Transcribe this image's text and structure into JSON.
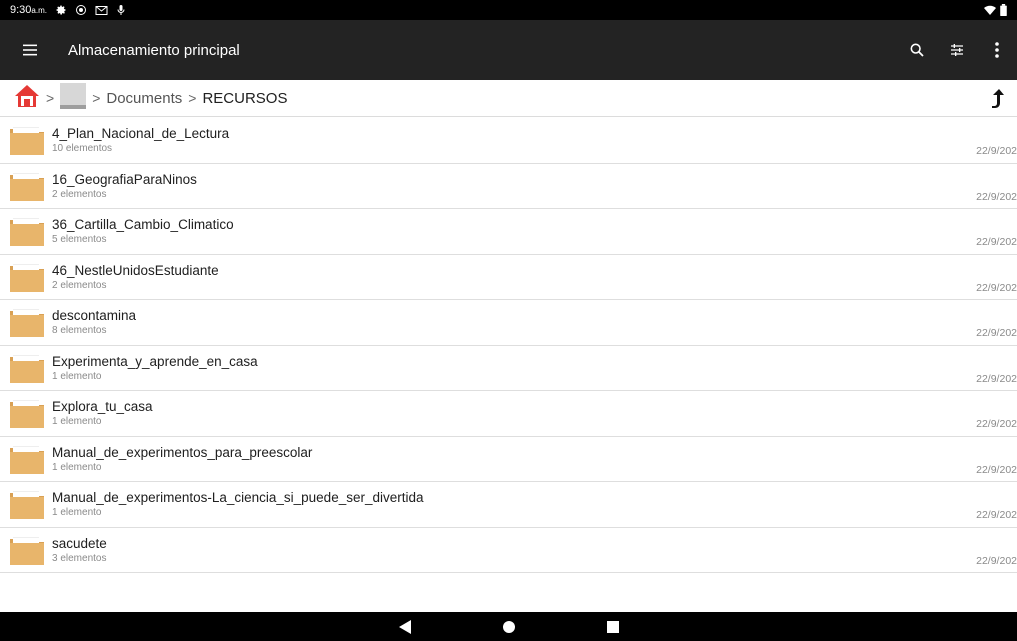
{
  "status_bar": {
    "time": "9:30",
    "time_suffix": "a.m.",
    "icons": [
      "gear-icon",
      "radio-icon",
      "gmail-icon",
      "mic-icon"
    ],
    "right_icons": [
      "wifi-icon",
      "battery-icon"
    ]
  },
  "app_bar": {
    "title": "Almacenamiento principal",
    "icons": [
      "menu-icon",
      "search-icon",
      "filter-icon",
      "more-vert-icon"
    ],
    "background": "#232323"
  },
  "breadcrumb": {
    "items": [
      "Documents",
      "RECURSOS"
    ],
    "separator": ">",
    "home_icon": "home-icon",
    "drive_icon": "drive-icon",
    "up_icon": "up-arrow-icon"
  },
  "folders": [
    {
      "name": "4_Plan_Nacional_de_Lectura",
      "count": "10 elementos",
      "date": "22/9/202"
    },
    {
      "name": "16_GeografiaParaNinos",
      "count": "2 elementos",
      "date": "22/9/202"
    },
    {
      "name": "36_Cartilla_Cambio_Climatico",
      "count": "5 elementos",
      "date": "22/9/202"
    },
    {
      "name": "46_NestleUnidosEstudiante",
      "count": "2 elementos",
      "date": "22/9/202"
    },
    {
      "name": "descontamina",
      "count": "8 elementos",
      "date": "22/9/202"
    },
    {
      "name": "Experimenta_y_aprende_en_casa",
      "count": "1 elemento",
      "date": "22/9/202"
    },
    {
      "name": "Explora_tu_casa",
      "count": "1 elemento",
      "date": "22/9/202"
    },
    {
      "name": "Manual_de_experimentos_para_preescolar",
      "count": "1 elemento",
      "date": "22/9/202"
    },
    {
      "name": "Manual_de_experimentos-La_ciencia_si_puede_ser_divertida",
      "count": "1 elemento",
      "date": "22/9/202"
    },
    {
      "name": "sacudete",
      "count": "3 elementos",
      "date": "22/9/202"
    }
  ],
  "colors": {
    "folder": "#e8b56b",
    "folder_dark": "#d9a155",
    "home_red": "#e53935"
  },
  "nav_bar": {
    "icons": [
      "back-icon",
      "home-circle-icon",
      "recents-icon"
    ]
  }
}
